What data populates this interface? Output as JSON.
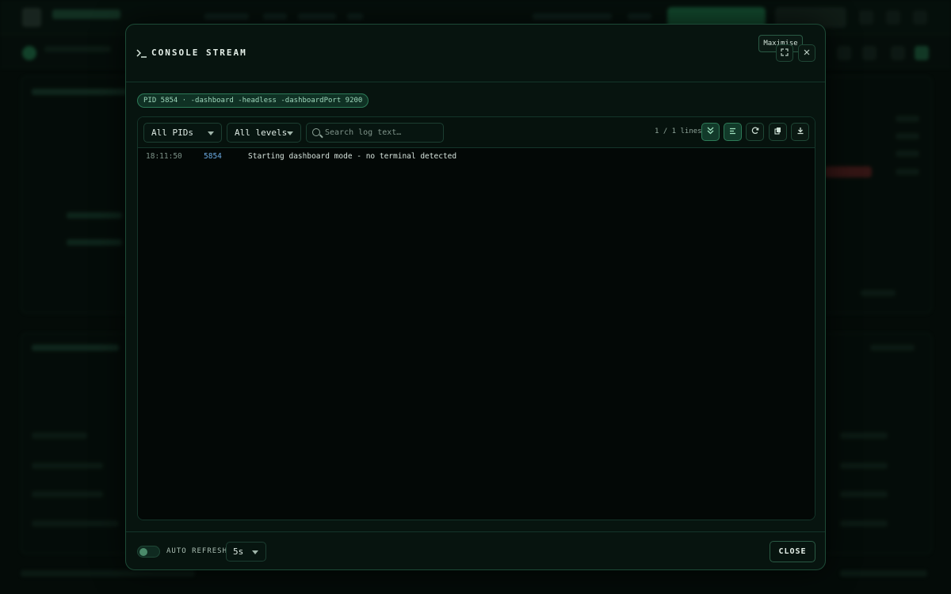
{
  "modal": {
    "title": "CONSOLE STREAM",
    "title_icon": "terminal-icon",
    "tooltip": "Maximise",
    "maximise_icon": "maximise-icon",
    "close_icon": "close-icon",
    "process_chip": "PID 5854 · -dashboard -headless -dashboardPort 9200"
  },
  "toolbar": {
    "pid_filter": {
      "selected": "All PIDs"
    },
    "level_filter": {
      "selected": "All levels"
    },
    "search": {
      "placeholder": "Search log text…",
      "value": ""
    },
    "line_count": "1 / 1 lines",
    "buttons": [
      {
        "icon": "scroll-to-bottom-icon",
        "active": true
      },
      {
        "icon": "wrap-lines-icon",
        "active": true
      },
      {
        "icon": "refresh-icon",
        "active": false
      },
      {
        "icon": "copy-icon",
        "active": false
      },
      {
        "icon": "download-icon",
        "active": false
      }
    ]
  },
  "logs": [
    {
      "time": "18:11:50",
      "pid": "5854",
      "message": "Starting dashboard mode - no terminal detected"
    }
  ],
  "footer": {
    "auto_refresh_label": "AUTO REFRESH",
    "auto_refresh_enabled": false,
    "interval": "5s",
    "close_label": "CLOSE"
  },
  "colors": {
    "accent": "#2c7a57",
    "pid_text": "#6aa9e0",
    "background": "#040b08"
  }
}
